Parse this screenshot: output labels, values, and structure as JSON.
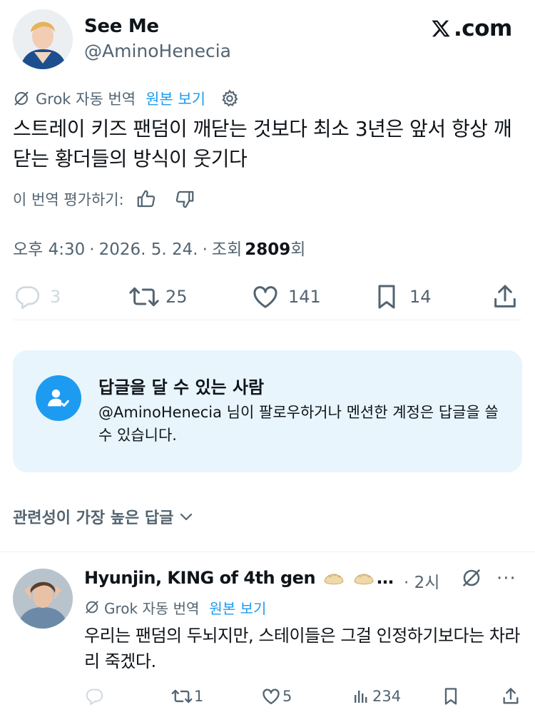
{
  "author": {
    "display_name": "See Me",
    "handle": "@AminoHenecia"
  },
  "site_logo": {
    "text": ".com",
    "icon": "x-logo-icon"
  },
  "translation": {
    "label": "Grok 자동 번역",
    "show_original": "원본 보기",
    "icon": "grok-icon",
    "settings_icon": "gear-icon"
  },
  "tweet": {
    "text": "스트레이 키즈 팬덤이 깨닫는 것보다 최소 3년은 앞서 항상 깨닫는 황더들의 방식이 웃기다"
  },
  "rating": {
    "prompt": "이 번역 평가하기:",
    "icons": [
      "thumbs-up-icon",
      "thumbs-down-icon"
    ]
  },
  "meta": {
    "time": "오후 4:30",
    "date": "2026. 5. 24.",
    "views_prefix": "조회",
    "views": "2809",
    "views_suffix": "회",
    "sep": "·"
  },
  "actions": {
    "replies": "3",
    "reposts": "25",
    "likes": "141",
    "bookmarks": "14"
  },
  "reply_restriction": {
    "title": "답글을 달 수 있는 사람",
    "body": "@AminoHenecia 님이 팔로우하거나 멘션한 계정은 답글을 쓸 수 있습니다."
  },
  "sort": {
    "label": "관련성이 가장 높은 답글"
  },
  "reply": {
    "display_name": "Hyunjin, KING of 4th gen",
    "ellipsis": "…",
    "time": "· 2시",
    "more": "···",
    "translation_label": "Grok 자동 번역",
    "show_original": "원본 보기",
    "text": "우리는 팬덤의 두뇌지만, 스테이들은 그걸 인정하기보다는 차라리 죽겠다.",
    "reposts": "1",
    "likes": "5",
    "views": "234"
  },
  "colors": {
    "text": "#0f1419",
    "secondary": "#536471",
    "accent": "#1d9bf0",
    "card_bg": "#e8f5fd",
    "divider": "#eff3f4"
  }
}
